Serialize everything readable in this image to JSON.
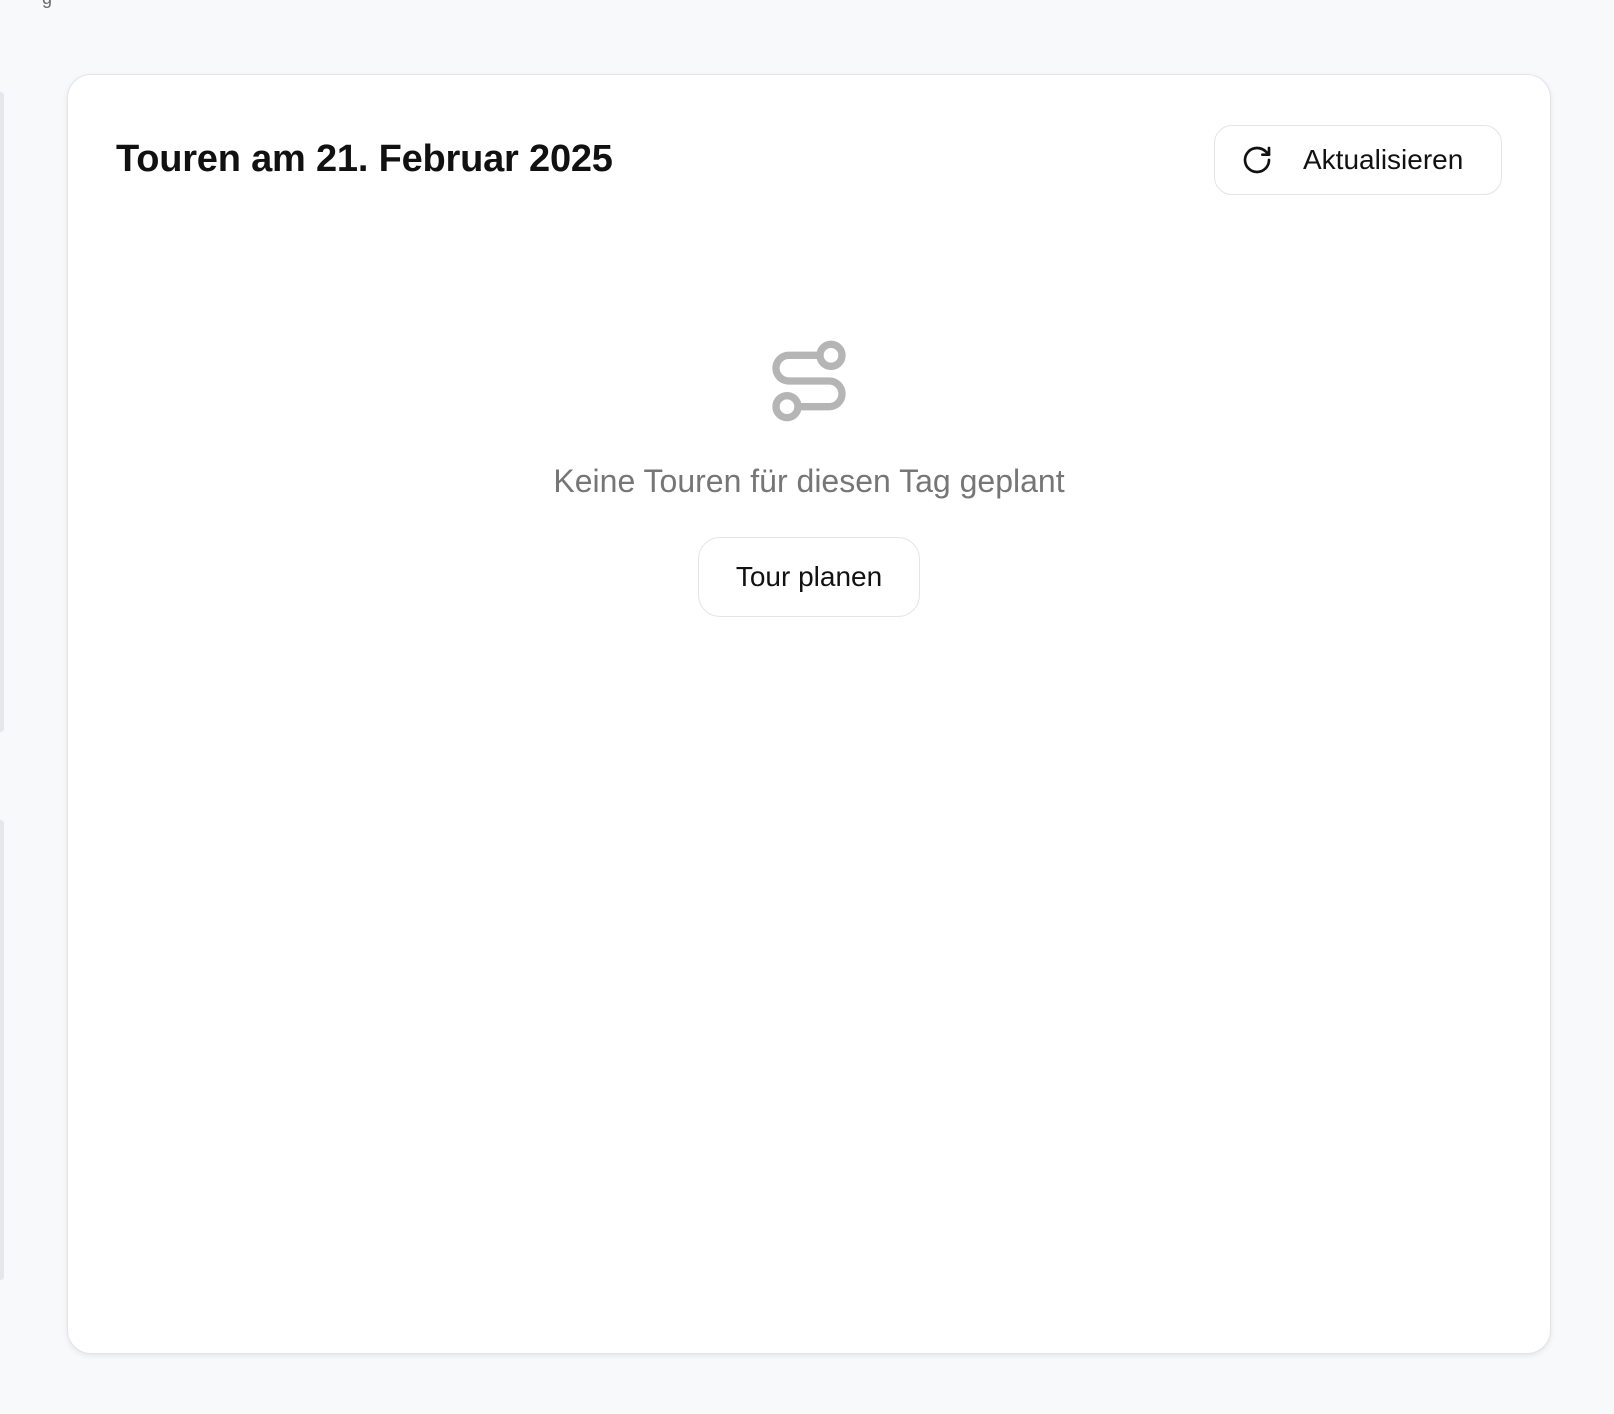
{
  "header": {
    "title": "Touren am 21. Februar 2025",
    "refresh_label": "Aktualisieren",
    "refresh_icon": "refresh-icon"
  },
  "empty_state": {
    "icon": "route-icon",
    "message": "Keine Touren für diesen Tag geplant",
    "plan_button_label": "Tour planen"
  },
  "partial_text": {
    "top_left": "g"
  },
  "colors": {
    "page_background": "#f8f9fb",
    "card_background": "#ffffff",
    "border": "#e4e4e7",
    "text_primary": "#111111",
    "text_muted": "#767676",
    "icon_muted": "#b5b5b5"
  }
}
